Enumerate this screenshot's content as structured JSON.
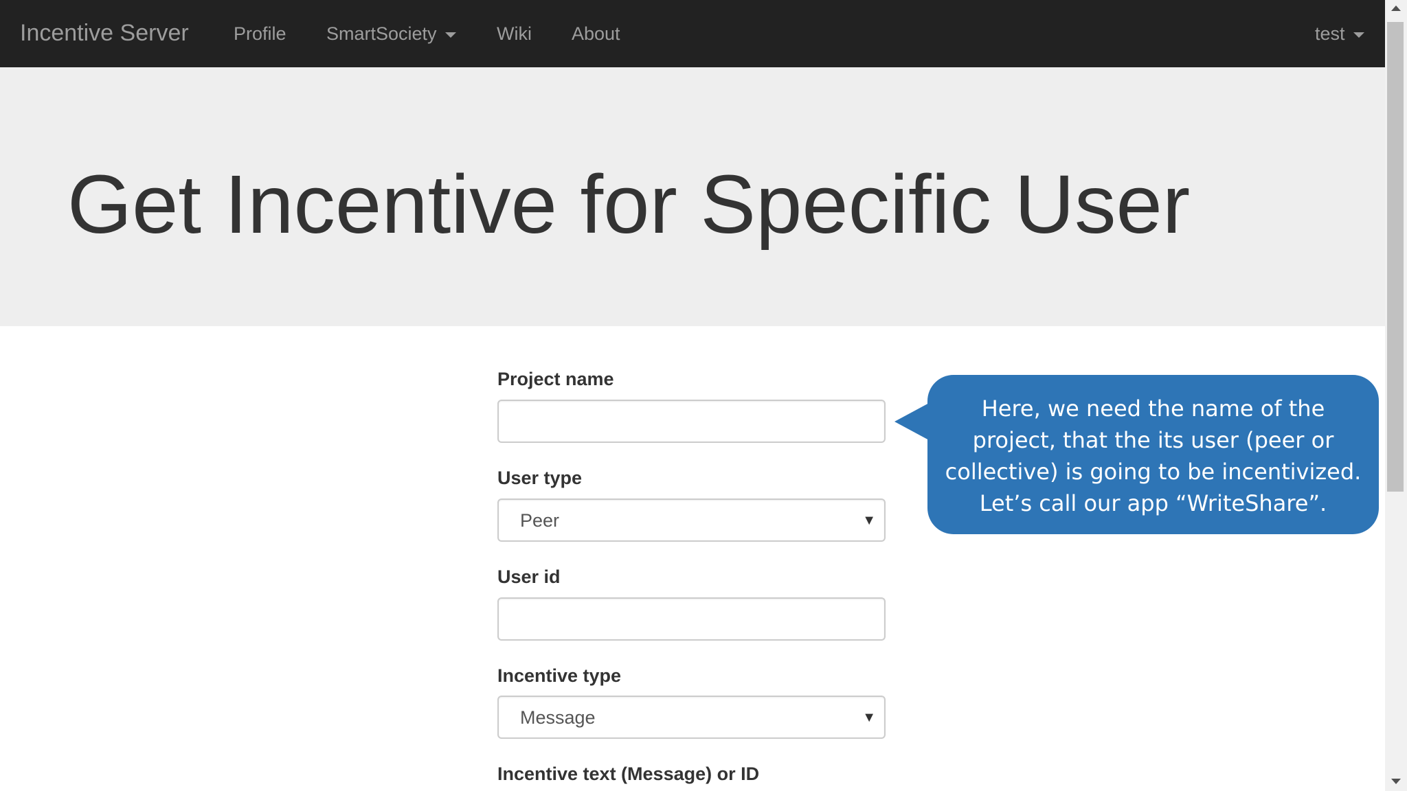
{
  "navbar": {
    "brand": "Incentive Server",
    "links": [
      {
        "label": "Profile"
      },
      {
        "label": "SmartSociety"
      },
      {
        "label": "Wiki"
      },
      {
        "label": "About"
      }
    ],
    "user": "test"
  },
  "page": {
    "title": "Get Incentive for Specific User"
  },
  "form": {
    "project_name": {
      "label": "Project name",
      "value": ""
    },
    "user_type": {
      "label": "User type",
      "selected": "Peer"
    },
    "user_id": {
      "label": "User id",
      "value": ""
    },
    "incentive_type": {
      "label": "Incentive type",
      "selected": "Message"
    },
    "incentive_text": {
      "label": "Incentive text (Message) or ID"
    }
  },
  "callout": {
    "lines": [
      "Here, we need the name of the",
      "project, that the its user (peer or",
      "collective) is going to be incentivized.",
      "Let’s call our app “WriteShare”."
    ],
    "color": "#2e75b6"
  }
}
